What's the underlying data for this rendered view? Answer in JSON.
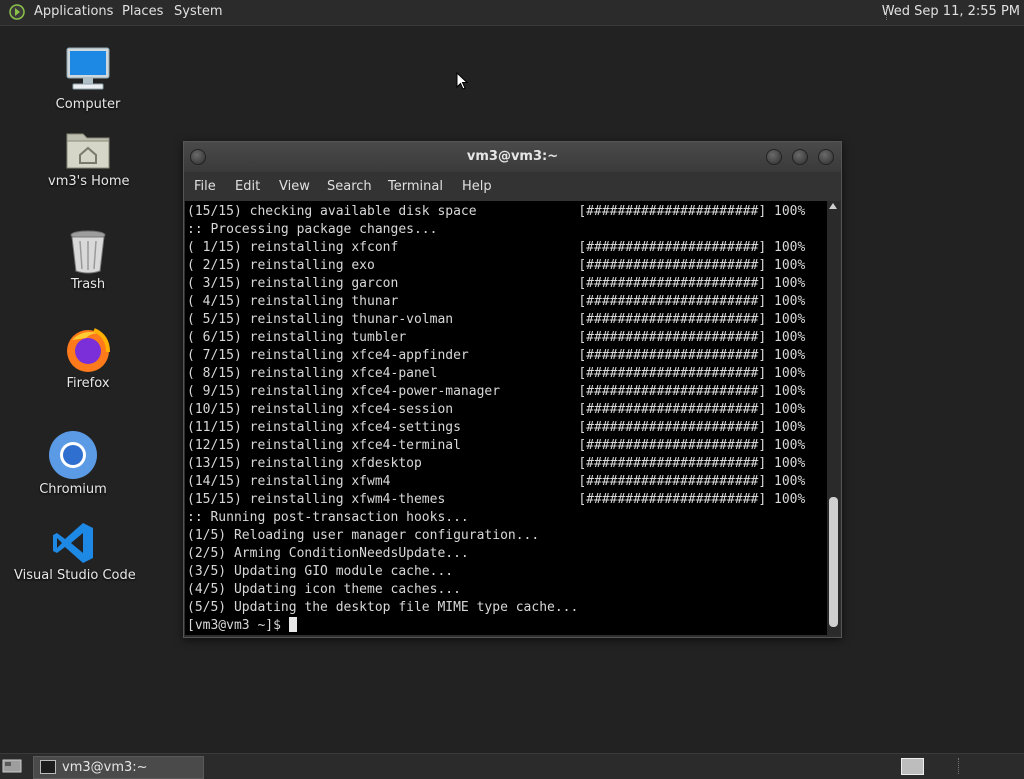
{
  "top_panel": {
    "menus": [
      "Applications",
      "Places",
      "System"
    ],
    "clock": "Wed Sep 11,  2:55 PM"
  },
  "desktop_icons": [
    {
      "label": "Computer",
      "icon": "computer-icon"
    },
    {
      "label": "vm3's Home",
      "icon": "home-folder-icon"
    },
    {
      "label": "Trash",
      "icon": "trash-icon"
    },
    {
      "label": "Firefox",
      "icon": "firefox-icon"
    },
    {
      "label": "Chromium",
      "icon": "chromium-icon"
    },
    {
      "label": "Visual Studio Code",
      "icon": "vscode-icon"
    }
  ],
  "terminal": {
    "title": "vm3@vm3:~",
    "menu": [
      "File",
      "Edit",
      "View",
      "Search",
      "Terminal",
      "Help"
    ],
    "lines": [
      "(15/15) checking available disk space             [######################] 100%",
      ":: Processing package changes...",
      "( 1/15) reinstalling xfconf                       [######################] 100%",
      "( 2/15) reinstalling exo                          [######################] 100%",
      "( 3/15) reinstalling garcon                       [######################] 100%",
      "( 4/15) reinstalling thunar                       [######################] 100%",
      "( 5/15) reinstalling thunar-volman                [######################] 100%",
      "( 6/15) reinstalling tumbler                      [######################] 100%",
      "( 7/15) reinstalling xfce4-appfinder              [######################] 100%",
      "( 8/15) reinstalling xfce4-panel                  [######################] 100%",
      "( 9/15) reinstalling xfce4-power-manager          [######################] 100%",
      "(10/15) reinstalling xfce4-session                [######################] 100%",
      "(11/15) reinstalling xfce4-settings               [######################] 100%",
      "(12/15) reinstalling xfce4-terminal               [######################] 100%",
      "(13/15) reinstalling xfdesktop                    [######################] 100%",
      "(14/15) reinstalling xfwm4                        [######################] 100%",
      "(15/15) reinstalling xfwm4-themes                 [######################] 100%",
      ":: Running post-transaction hooks...",
      "(1/5) Reloading user manager configuration...",
      "(2/5) Arming ConditionNeedsUpdate...",
      "(3/5) Updating GIO module cache...",
      "(4/5) Updating icon theme caches...",
      "(5/5) Updating the desktop file MIME type cache..."
    ],
    "prompt": "[vm3@vm3 ~]$ "
  },
  "taskbar": {
    "window_label": "vm3@vm3:~"
  },
  "colors": {
    "panel_bg": "#2b2b2b",
    "desktop_bg": "#222222",
    "terminal_bg": "#000000",
    "terminal_fg": "#d8d8d8"
  }
}
